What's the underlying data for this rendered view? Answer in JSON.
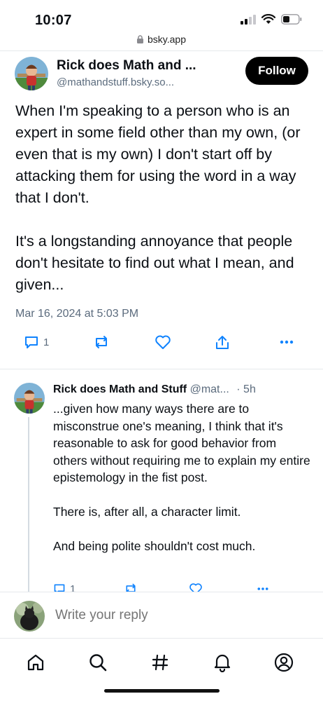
{
  "status_bar": {
    "time": "10:07"
  },
  "browser": {
    "url": "bsky.app"
  },
  "post": {
    "author_name": "Rick does Math and ...",
    "author_handle": "@mathandstuff.bsky.so...",
    "follow_label": "Follow",
    "paragraphs": [
      "When I'm speaking to a person who is an expert in some field other than my own, (or even that is my own) I don't start off by attacking them for using the word in a way that I don't.",
      "It's a longstanding annoyance that people don't hesitate to find out what I mean, and given..."
    ],
    "timestamp": "Mar 16, 2024 at 5:03 PM",
    "reply_count": "1"
  },
  "reply": {
    "author_name": "Rick does Math and Stuff",
    "author_handle": "@mat...",
    "time": "· 5h",
    "paragraphs": [
      "...given how many ways there are to misconstrue one's meaning, I think that it's reasonable to ask for good behavior from others without requiring me to explain my entire epistemology in the fist post.",
      "There is, after all, a character limit.",
      "And being polite shouldn't cost much."
    ],
    "reply_count": "1"
  },
  "composer": {
    "placeholder": "Write your reply"
  },
  "colors": {
    "accent": "#1083fe",
    "icon": "#5b6b7d",
    "text": "#0b0f14",
    "follow_bg": "#000000"
  },
  "nav_icons": [
    "home-icon",
    "search-icon",
    "hashtag-icon",
    "notifications-icon",
    "profile-icon"
  ]
}
